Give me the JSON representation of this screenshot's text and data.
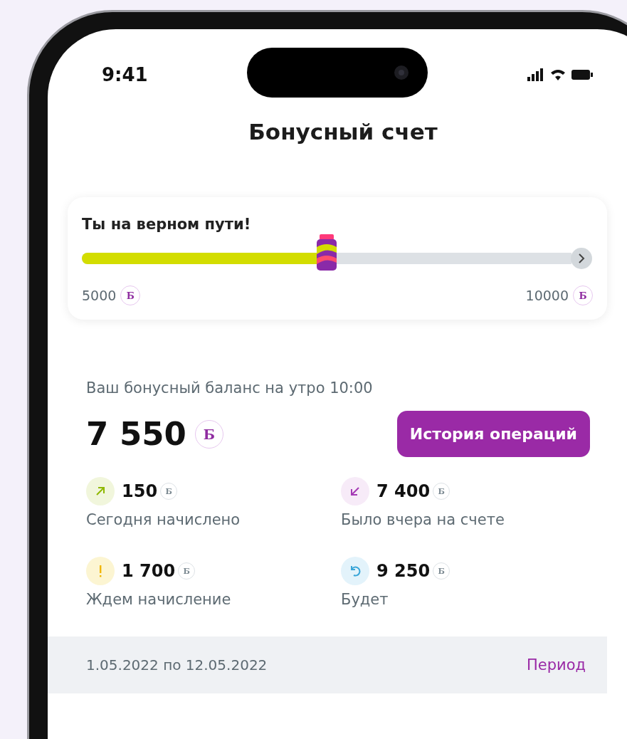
{
  "status_bar": {
    "time": "9:41"
  },
  "header": {
    "title": "Бонусный счет"
  },
  "progress_card": {
    "title": "Ты на верном пути!",
    "level": 0.5,
    "min_label": "5000",
    "min_currency": "Б",
    "max_label": "10000",
    "max_currency": "Б"
  },
  "balance": {
    "caption": "Ваш бонусный баланс на утро 10:00",
    "amount": "7 550",
    "currency": "Б",
    "button": "История операций"
  },
  "stats": [
    {
      "kind": "up",
      "value": "150",
      "currency": "Б",
      "label": "Сегодня начислено"
    },
    {
      "kind": "down",
      "value": "7 400",
      "currency": "Б",
      "label": "Было вчера на счете"
    },
    {
      "kind": "pending",
      "value": "1 700",
      "currency": "Б",
      "label": "Ждем начисление"
    },
    {
      "kind": "forecast",
      "value": "9 250",
      "currency": "Б",
      "label": "Будет"
    }
  ],
  "period_bar": {
    "range": "1.05.2022 по 12.05.2022",
    "action": "Период"
  }
}
